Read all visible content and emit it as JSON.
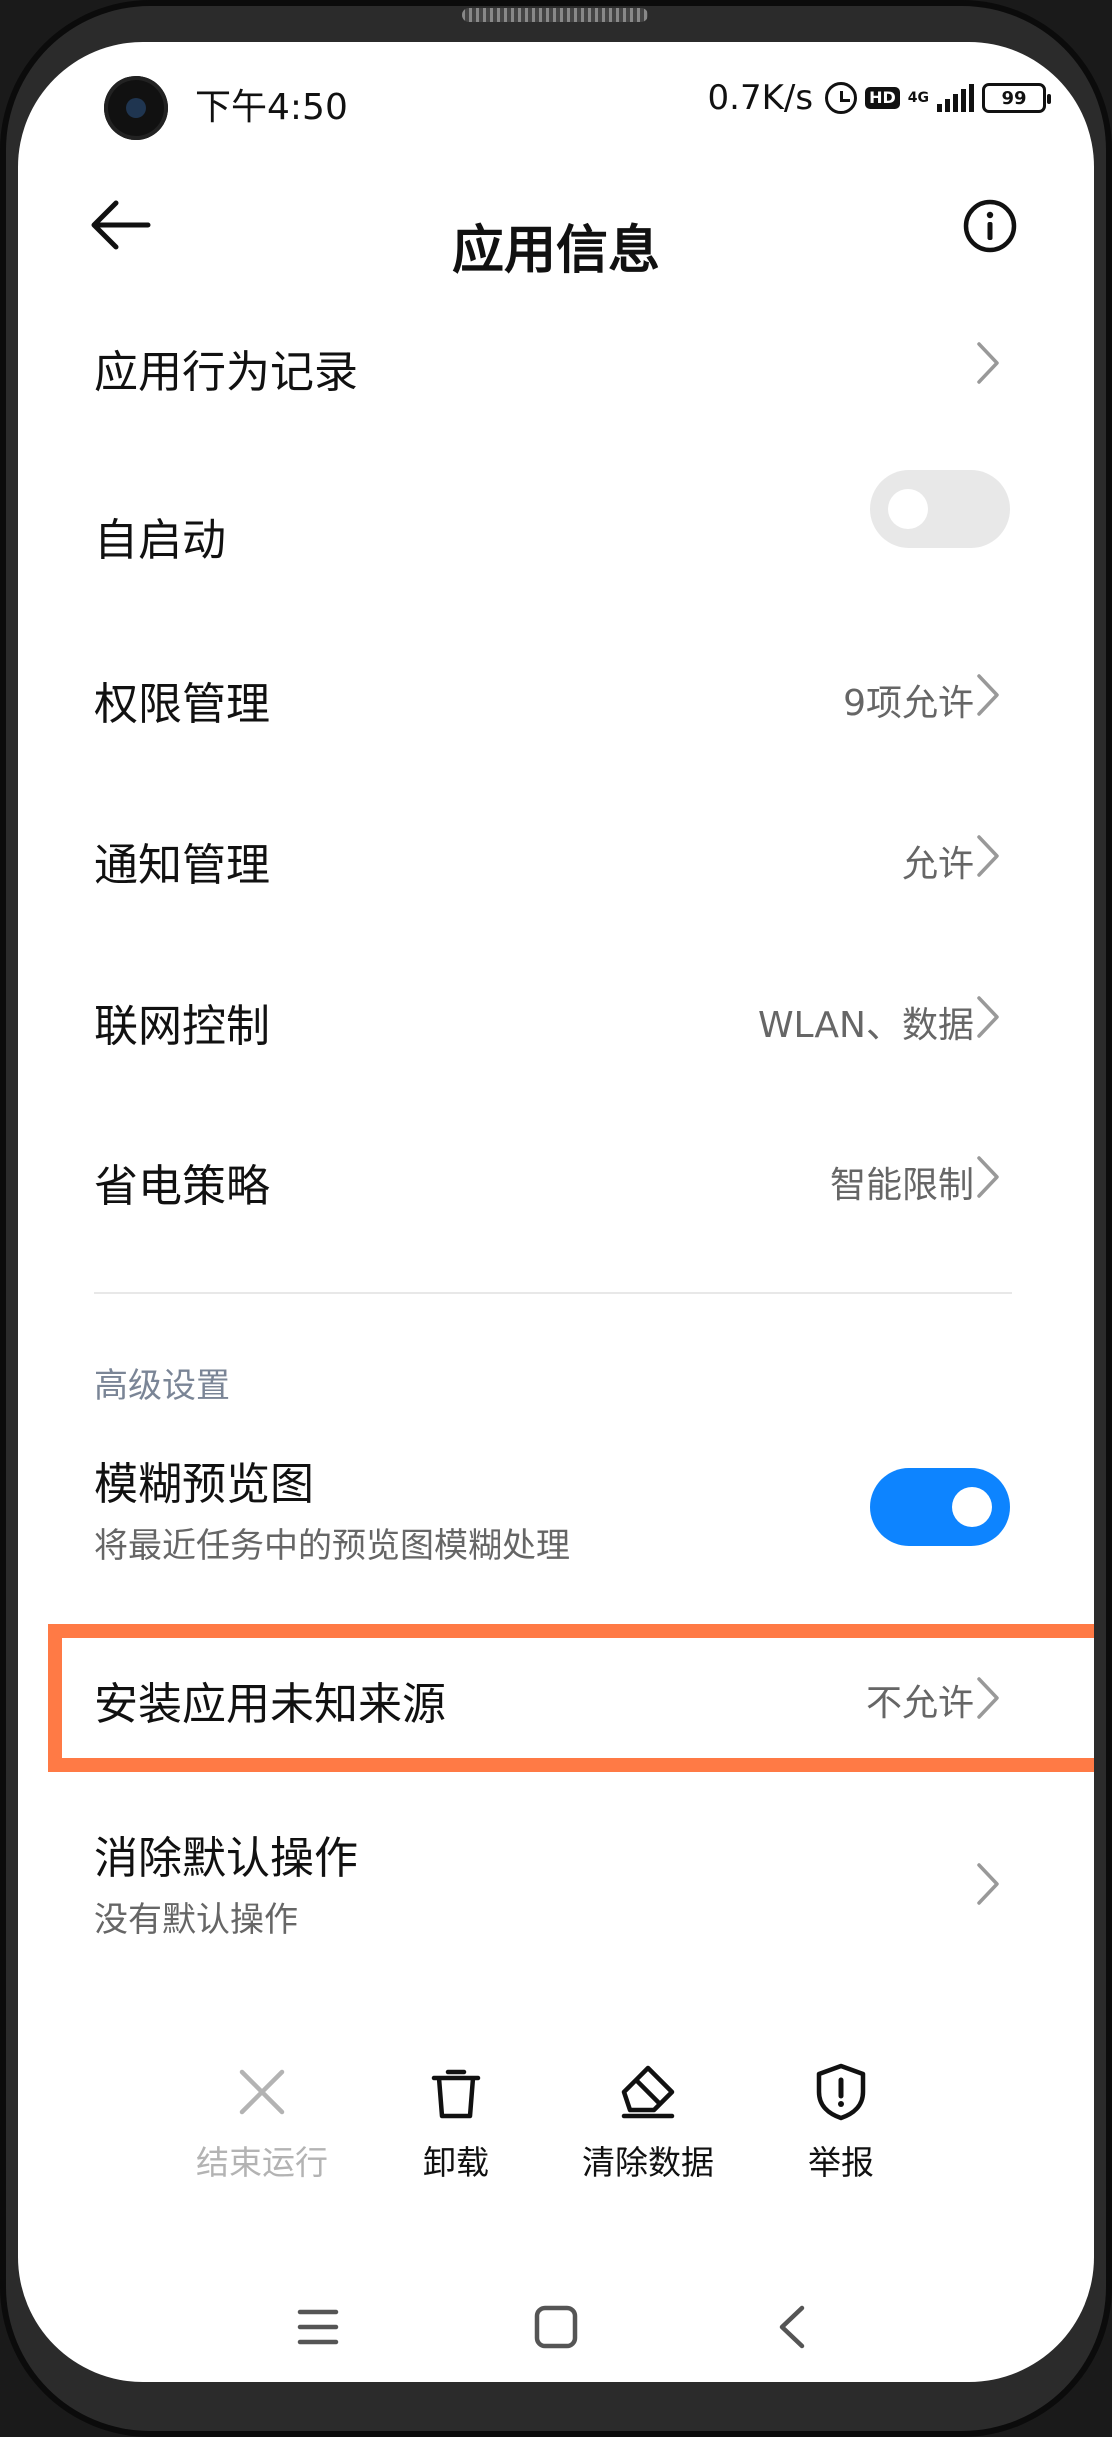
{
  "status_bar": {
    "time": "下午4:50",
    "net_speed": "0.7K/s",
    "hd": "HD",
    "network_type": "4G",
    "battery": "99"
  },
  "header": {
    "title": "应用信息"
  },
  "rows": {
    "behavior_log": {
      "title": "应用行为记录"
    },
    "autostart": {
      "title": "自启动",
      "enabled": false
    },
    "permissions": {
      "title": "权限管理",
      "value": "9项允许"
    },
    "notifications": {
      "title": "通知管理",
      "value": "允许"
    },
    "network": {
      "title": "联网控制",
      "value": "WLAN、数据"
    },
    "battery_saver": {
      "title": "省电策略",
      "value": "智能限制"
    }
  },
  "advanced": {
    "section_title": "高级设置",
    "blur_preview": {
      "title": "模糊预览图",
      "subtitle": "将最近任务中的预览图模糊处理",
      "enabled": true
    },
    "unknown_sources": {
      "title": "安装应用未知来源",
      "value": "不允许"
    },
    "clear_defaults": {
      "title": "消除默认操作",
      "subtitle": "没有默认操作"
    }
  },
  "actions": {
    "force_stop": "结束运行",
    "uninstall": "卸载",
    "clear_data": "清除数据",
    "report": "举报"
  },
  "colors": {
    "accent": "#0d84ff",
    "highlight": "#ff7a45"
  }
}
